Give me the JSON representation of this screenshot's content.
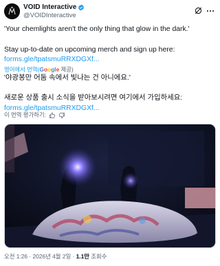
{
  "post": {
    "display_name": "VOID Interactive",
    "handle": "@VOIDInteractive",
    "text_line1": "'Your chemlights aren't the only thing that glow in the dark.'",
    "text_line2": "Stay up-to-date on upcoming merch and sign up here:",
    "link1": "forms.gle/tpatsmuRRXDGXf...",
    "translate_prefix": "영어에서 번역(",
    "translate_google": [
      "G",
      "o",
      "o",
      "g",
      "l",
      "e"
    ],
    "translate_suffix": " 제공)",
    "ko_line1": "'야광봉만 어둠 속에서 빛나는 건 아니에요.'",
    "ko_line2": "새로운 상품 출시 소식을 받아보시려면 여기에서 가입하세요:",
    "link2": "forms.gle/tpatsmuRRXDGXf...",
    "rate_label": "이 번역 평가하기:",
    "time": "오전 1:26 · 2026년 4월 2일 · ",
    "views_count": "1.1만",
    "views_label": " 조회수"
  },
  "icons": {
    "verified": "verified-badge-icon",
    "grok": "grok-icon",
    "more": "more-options-icon",
    "thumbs_up": "thumbs-up-icon",
    "thumbs_down": "thumbs-down-icon"
  },
  "colors": {
    "link": "#1d9bf0",
    "secondary": "#536471",
    "verified": "#1d9bf0"
  }
}
